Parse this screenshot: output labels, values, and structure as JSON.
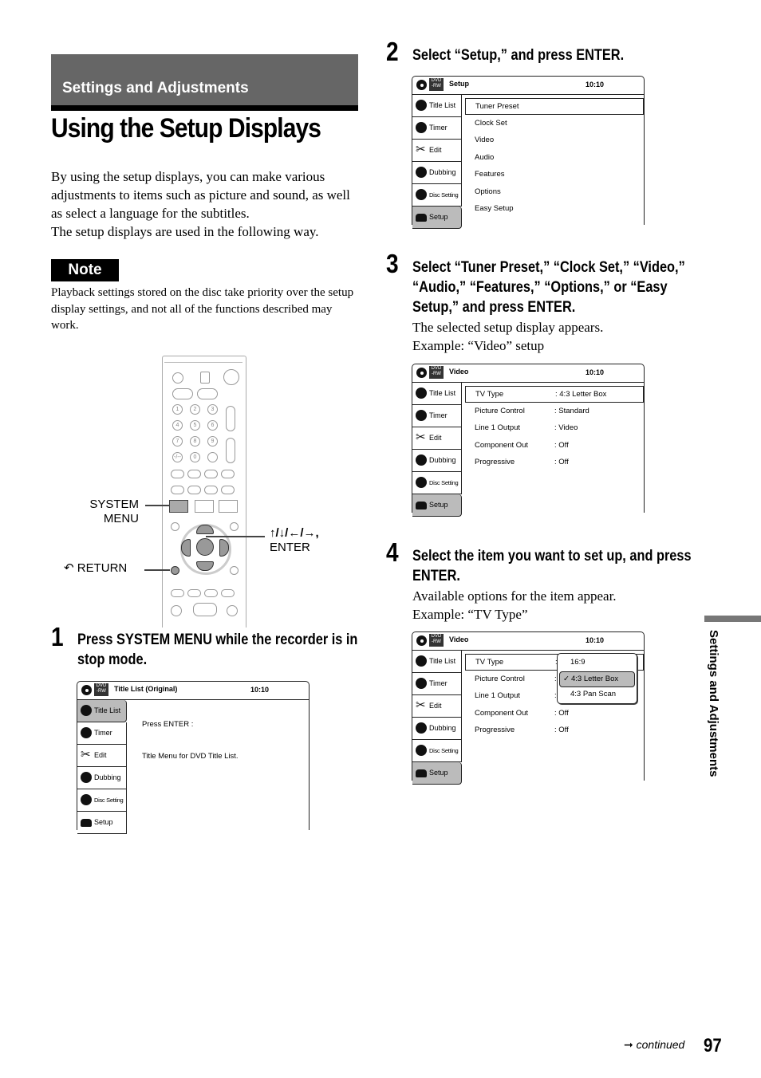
{
  "section": {
    "label": "Settings and Adjustments"
  },
  "page_title": "Using the Setup Displays",
  "intro": {
    "p1": "By using the setup displays, you can make various adjustments to items such as picture and sound, as well as select a language for the subtitles.",
    "p2": "The setup displays are used in the following way."
  },
  "note": {
    "badge": "Note",
    "text": "Playback settings stored on the disc take priority over the setup display settings, and not all of the functions described may work."
  },
  "remote": {
    "system_menu_label_1": "SYSTEM",
    "system_menu_label_2": "MENU",
    "arrows_label": "↑/↓/←/→,",
    "enter_label": "ENTER",
    "return_label": "RETURN",
    "return_icon": "↶",
    "digits": [
      "1",
      "2",
      "3",
      "4",
      "5",
      "6",
      "7",
      "8",
      "9",
      "-/--",
      "0",
      ""
    ]
  },
  "steps": [
    {
      "number": "1",
      "heading": "Press SYSTEM MENU while the recorder is in stop mode.",
      "body": ""
    },
    {
      "number": "2",
      "heading": "Select “Setup,” and press ENTER.",
      "body": ""
    },
    {
      "number": "3",
      "heading": "Select “Tuner Preset,” “Clock Set,” “Video,” “Audio,” “Features,” “Options,” or “Easy Setup,” and press ENTER.",
      "body_1": "The selected setup display appears.",
      "body_2": "Example: “Video” setup"
    },
    {
      "number": "4",
      "heading": "Select the item you want to set up, and press ENTER.",
      "body_1": "Available options for the item appear.",
      "body_2": "Example: “TV Type”"
    }
  ],
  "osd_common": {
    "dvd_badge_1": "DVD",
    "dvd_badge_2": "-RW",
    "clock": "10:10",
    "sidebar": [
      "Title List",
      "Timer",
      "Edit",
      "Dubbing",
      "Disc Setting",
      "Setup"
    ]
  },
  "screen1": {
    "title": "Title List (Original)",
    "active_sidebar": "Title List",
    "line1": "Press ENTER :",
    "line2": "Title Menu for DVD Title List."
  },
  "screen2": {
    "title": "Setup",
    "active_sidebar": "Setup",
    "items": [
      "Tuner Preset",
      "Clock Set",
      "Video",
      "Audio",
      "Features",
      "Options",
      "Easy Setup"
    ],
    "selected": "Tuner Preset"
  },
  "screen3": {
    "title": "Video",
    "active_sidebar": "Setup",
    "rows": [
      {
        "key": "TV Type",
        "value": ":  4:3 Letter Box"
      },
      {
        "key": "Picture Control",
        "value": ":  Standard"
      },
      {
        "key": "Line 1 Output",
        "value": ":  Video"
      },
      {
        "key": "Component Out",
        "value": ":  Off"
      },
      {
        "key": "Progressive",
        "value": ":  Off"
      }
    ],
    "selected": "TV Type"
  },
  "screen4": {
    "title": "Video",
    "active_sidebar": "Setup",
    "rows": [
      {
        "key": "TV Type",
        "value": ":"
      },
      {
        "key": "Picture Control",
        "value": ":"
      },
      {
        "key": "Line 1 Output",
        "value": ":"
      },
      {
        "key": "Component Out",
        "value": ":  Off"
      },
      {
        "key": "Progressive",
        "value": ":  Off"
      }
    ],
    "popup_options": [
      "16:9",
      "4:3 Letter Box",
      "4:3 Pan Scan"
    ],
    "popup_selected": "4:3 Letter Box",
    "check_mark": "✓"
  },
  "side_tab": {
    "label": "Settings and Adjustments"
  },
  "footer": {
    "continued": "continued",
    "continued_arrow": "➞",
    "page_number": "97"
  }
}
